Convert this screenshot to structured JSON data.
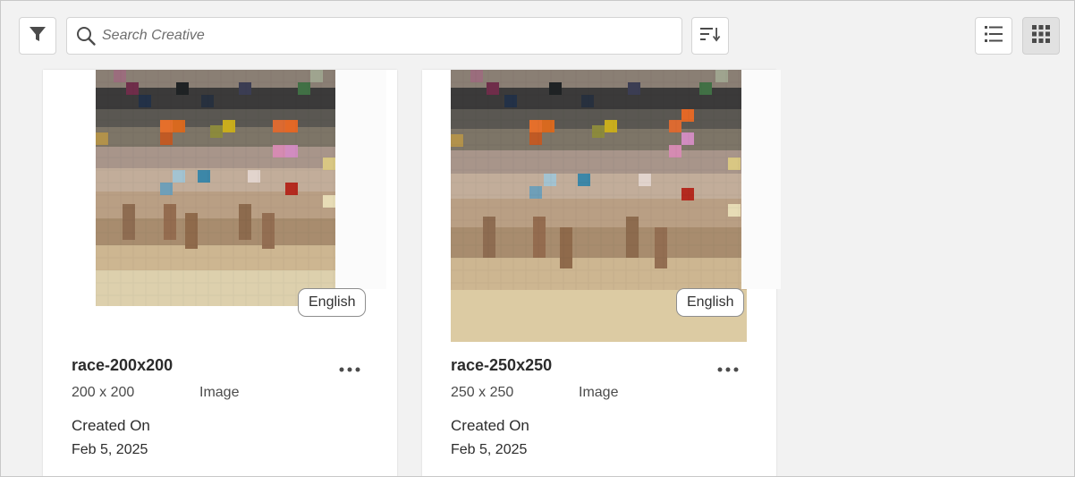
{
  "toolbar": {
    "search_placeholder": "Search Creative",
    "filter_icon": "filter-icon",
    "sort_icon": "sort-icon",
    "list_view_icon": "list-view-icon",
    "grid_view_icon": "grid-view-icon",
    "active_view": "grid"
  },
  "cards": [
    {
      "title": "race-200x200",
      "dimensions": "200 x 200",
      "type": "Image",
      "language": "English",
      "created_label": "Created On",
      "created_date": "Feb 5, 2025"
    },
    {
      "title": "race-250x250",
      "dimensions": "250 x 250",
      "type": "Image",
      "language": "English",
      "created_label": "Created On",
      "created_date": "Feb 5, 2025"
    }
  ],
  "colors": {
    "background": "#f2f2f2",
    "card": "#ffffff",
    "border": "#d4d4d4",
    "selected_button": "#e1e1e1"
  }
}
